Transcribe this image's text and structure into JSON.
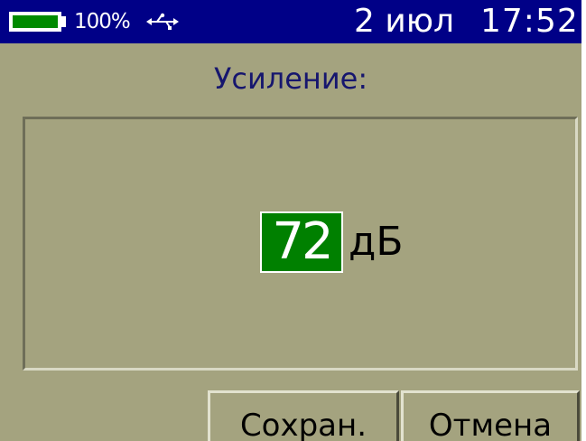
{
  "status_bar": {
    "battery_level": 1.0,
    "battery_percent": "100%",
    "usb_icon": "usb-icon",
    "date": "2 июл",
    "time": "17:52"
  },
  "dialog": {
    "title": "Усиление:",
    "gain_value": "72",
    "gain_unit": "дБ"
  },
  "buttons": {
    "save_label": "Сохран.",
    "cancel_label": "Отмена"
  },
  "colors": {
    "status_bar_bg": "#000087",
    "screen_bg": "#a4a37f",
    "title_text": "#16166e",
    "value_highlight": "#008000",
    "battery_fill": "#008a00"
  }
}
